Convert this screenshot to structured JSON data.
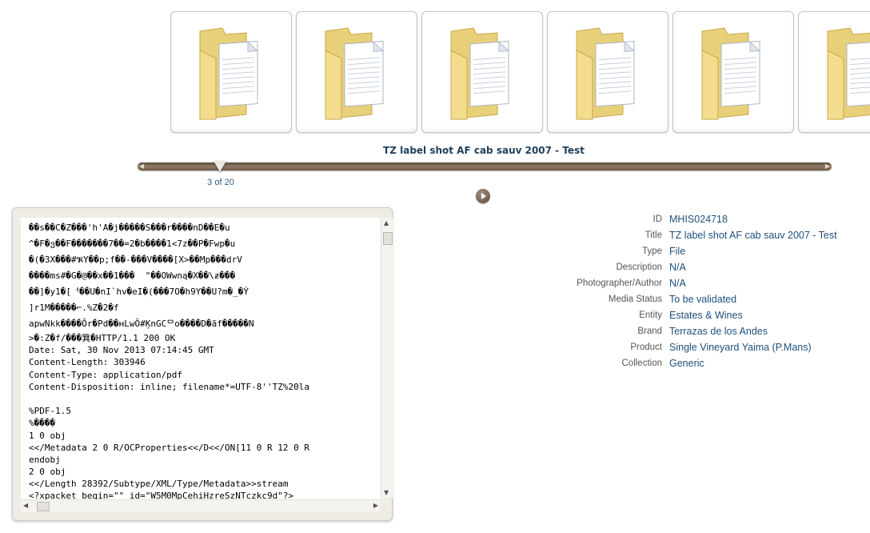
{
  "media": {
    "title": "TZ label shot AF cab sauv 2007 - Test",
    "position": "3 of 20",
    "current_index": 3,
    "total": 20
  },
  "thumbnails": [
    {
      "icon": "folder-icon"
    },
    {
      "icon": "folder-icon"
    },
    {
      "icon": "folder-icon"
    },
    {
      "icon": "folder-icon"
    },
    {
      "icon": "folder-icon"
    },
    {
      "icon": "folder-icon"
    }
  ],
  "preview": {
    "lines": [
      "��s��C�Z���'h'A�j�����S���r����nD��E�u",
      "^�F�ვ��F�������7��=2�b����1<7z��P�Fwp�u",
      "�(�3X���#ᎍY��p;f��-���V����[X>��Mp���drV",
      "����ms#�G�@��x��1���  \"��OWwną�X��\\ƶ���",
      "��]�y1�[ᅥ��U�nI`hᴠ�eI�(���7O�h9Y��U?m�_�Ý",
      "]r1M�����⌐.%Z�2�f",
      "apwNkk����Ŏr�Pd��ʜLwÖ#ĶnGCᄆo����D�ãf�����N",
      ">�:Z�f/���箕�HTTP/1.1 200 OK",
      "Date: Sat, 30 Nov 2013 07:14:45 GMT",
      "Content-Length: 303946",
      "Content-Type: application/pdf",
      "Content-Disposition: inline; filename*=UTF-8''TZ%20la",
      "",
      "%PDF-1.5",
      "%����",
      "1 0 obj",
      "<</Metadata 2 0 R/OCProperties<</D<</ON[11 0 R 12 0 R",
      "endobj",
      "2 0 obj",
      "<</Length 28392/Subtype/XML/Type/Metadata>>stream",
      "<?xpacket begin=\"\" id=\"W5M0MpCehiHzreSzNTczkc9d\"?>"
    ]
  },
  "details": [
    {
      "label": "ID",
      "value": "MHIS024718"
    },
    {
      "label": "Title",
      "value": "TZ label shot AF cab sauv 2007 - Test"
    },
    {
      "label": "Type",
      "value": "File"
    },
    {
      "label": "Description",
      "value": "N/A"
    },
    {
      "label": "Photographer/Author",
      "value": "N/A"
    },
    {
      "label": "Media Status",
      "value": "To be validated"
    },
    {
      "label": "Entity",
      "value": "Estates & Wines"
    },
    {
      "label": "Brand",
      "value": "Terrazas de los Andes"
    },
    {
      "label": "Product",
      "value": "Single Vineyard Yaima (P.Mans)"
    },
    {
      "label": "Collection",
      "value": "Generic"
    }
  ]
}
